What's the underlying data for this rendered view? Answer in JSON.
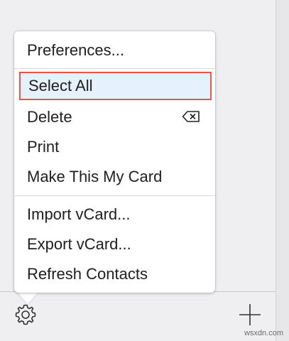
{
  "menu": {
    "items": [
      {
        "label": "Preferences..."
      },
      {
        "label": "Select All"
      },
      {
        "label": "Delete",
        "shortcut_icon": "delete-key-icon"
      },
      {
        "label": "Print"
      },
      {
        "label": "Make This My Card"
      },
      {
        "label": "Import vCard..."
      },
      {
        "label": "Export vCard..."
      },
      {
        "label": "Refresh Contacts"
      }
    ],
    "selected_item": "Select All"
  },
  "toolbar": {
    "left_icon": "gear-icon",
    "right_icon": "plus-icon"
  },
  "watermark": {
    "text": "wsxdn.com"
  },
  "colors": {
    "background": "#efeff1",
    "menu_background": "#ffffff",
    "selection_fill": "#e5f1fc",
    "selection_border": "#e5554a",
    "text": "#202020"
  }
}
